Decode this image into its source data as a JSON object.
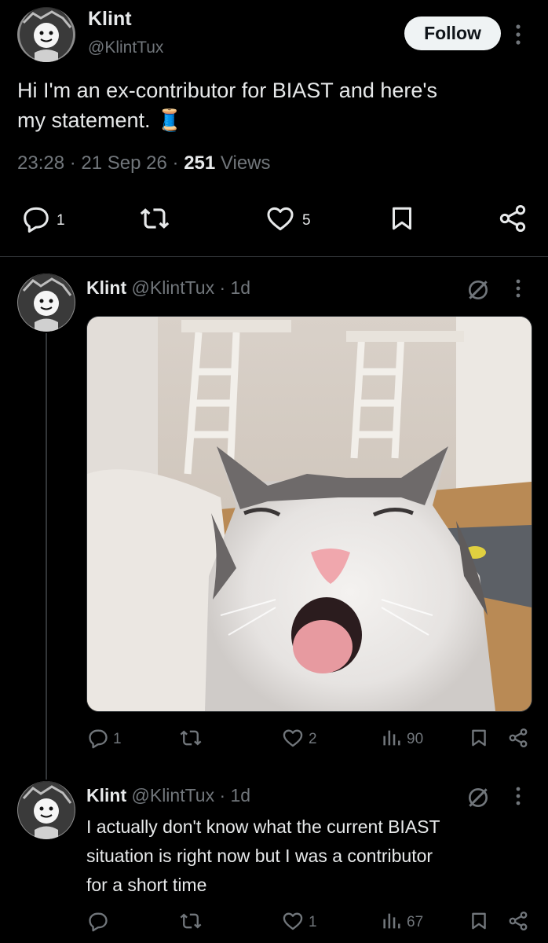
{
  "main_post": {
    "display_name": "Klint",
    "handle": "@KlintTux",
    "follow_label": "Follow",
    "text_line1": "Hi I'm an ex-contributor for BIAST and here's",
    "text_line2": "my statement.",
    "emoji": "🧵",
    "time": "23:28",
    "date": "21 Sep 26",
    "views_count": "251",
    "views_label": "Views",
    "separator": "·",
    "reply_count": "1",
    "like_count": "5"
  },
  "reply1": {
    "display_name": "Klint",
    "handle_time": "@KlintTux · 1d",
    "reply_count": "1",
    "like_count": "2",
    "view_count": "90"
  },
  "reply2": {
    "display_name": "Klint",
    "handle_time": "@KlintTux · 1d",
    "text_line1": "I actually don't know what the current BIAST",
    "text_line2": "situation is right now but I was a contributor",
    "text_line3": "for a short time",
    "like_count": "1",
    "view_count": "67"
  },
  "icons": {
    "reply": "reply-icon",
    "repost": "repost-icon",
    "like": "heart-icon",
    "bookmark": "bookmark-icon",
    "share": "share-icon",
    "views": "views-bar-icon",
    "more": "more-vertical-icon",
    "grok": "grok-icon"
  },
  "colors": {
    "background": "#000000",
    "text": "#e7e9ea",
    "muted": "#71767b",
    "divider": "#2f3336",
    "follow_bg": "#eff3f4"
  }
}
